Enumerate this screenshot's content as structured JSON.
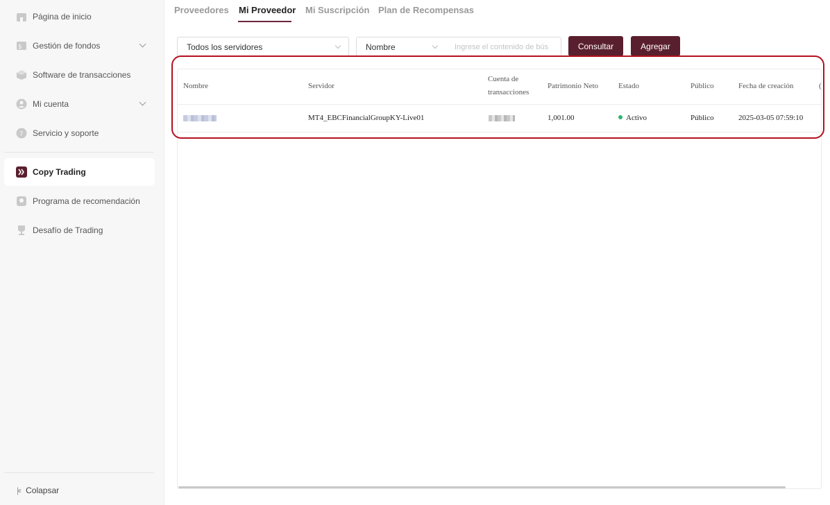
{
  "sidebar": {
    "items": [
      {
        "label": "Página de inicio"
      },
      {
        "label": "Gestión de fondos"
      },
      {
        "label": "Software de transacciones"
      },
      {
        "label": "Mi cuenta"
      },
      {
        "label": "Servicio y soporte"
      },
      {
        "label": "Copy Trading"
      },
      {
        "label": "Programa de recomendación"
      },
      {
        "label": "Desafío de Trading"
      }
    ],
    "collapse_label": "Colapsar"
  },
  "tabs": [
    {
      "label": "Proveedores"
    },
    {
      "label": "Mi Proveedor"
    },
    {
      "label": "Mi Suscripción"
    },
    {
      "label": "Plan de Recompensas"
    }
  ],
  "filters": {
    "server_select": "Todos los servidores",
    "field_select": "Nombre",
    "search_placeholder": "Ingrese el contenido de bús",
    "query_button": "Consultar",
    "add_button": "Agregar"
  },
  "table": {
    "columns": {
      "name": "Nombre",
      "server": "Servidor",
      "account": "Cuenta de transacciones",
      "equity": "Patrimonio Neto",
      "status": "Estado",
      "public": "Público",
      "created": "Fecha de creación"
    },
    "rows": [
      {
        "server": "MT4_EBCFinancialGroupKY-Live01",
        "equity": "1,001.00",
        "status": "Activo",
        "public": "Público",
        "created": "2025-03-05 07:59:10"
      }
    ]
  },
  "colors": {
    "accent": "#5a1f2e",
    "tab_underline": "#6b2438",
    "status_active": "#2bb673",
    "annotation": "#b4101e"
  }
}
